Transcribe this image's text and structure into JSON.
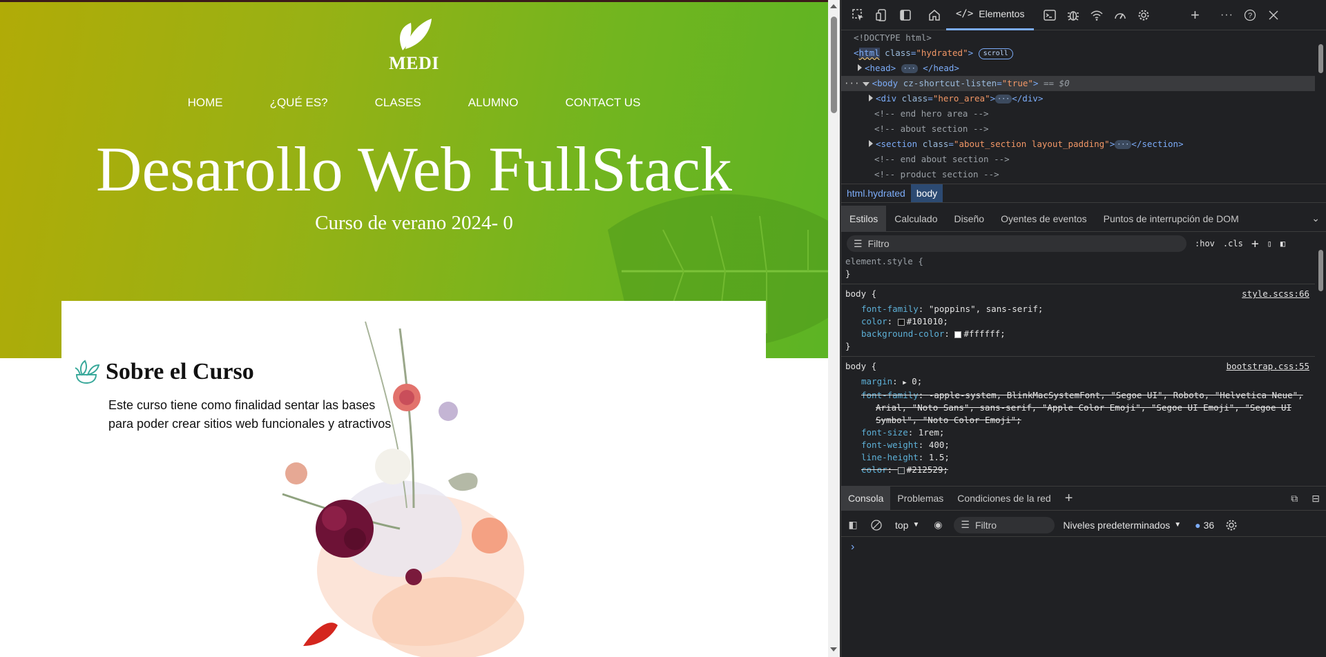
{
  "site": {
    "logo_text": "MEDI",
    "nav": [
      "HOME",
      "¿QUÉ ES?",
      "CLASES",
      "ALUMNO",
      "CONTACT US"
    ],
    "hero_title": "Desarollo Web FullStack",
    "hero_subtitle": "Curso de verano 2024- 0",
    "about_title": "Sobre el Curso",
    "about_text": "Este curso tiene como finalidad sentar las bases para poder crear sitios web funcionales y atractivos",
    "colors": {
      "hero_start": "#b1ab07",
      "hero_end": "#5cb424"
    }
  },
  "devtools": {
    "active_tab": "Elementos",
    "toolbar_icons": [
      "inspect-icon",
      "device-icon",
      "sidebar-icon",
      "home-icon",
      "elements-icon",
      "console-icon",
      "bug-icon",
      "wifi-icon",
      "performance-icon",
      "settings-gear-icon",
      "plus-icon",
      "more-icon",
      "help-icon",
      "close-icon"
    ],
    "dom": {
      "doctype": "<!DOCTYPE html>",
      "html_tag": "html",
      "html_class_attr": "class",
      "html_class_val": "\"hydrated\"",
      "scroll_badge": "scroll",
      "head_open": "<head>",
      "head_close": "</head>",
      "body_tag": "<body",
      "body_attr": "cz-shortcut-listen",
      "body_val": "\"true\"",
      "body_eq": "== $0",
      "div_open": "<div",
      "div_class": "\"hero_area\"",
      "div_close": "</div>",
      "cmt1": "<!-- end hero area -->",
      "cmt2": "<!-- about section -->",
      "section_open": "<section",
      "section_class": "\"about_section layout_padding\"",
      "section_close": "</section>",
      "cmt3": "<!-- end about section -->",
      "cmt4": "<!-- product section -->",
      "class_attr": "class",
      "dots": "···"
    },
    "breadcrumb": [
      "html.hydrated",
      "body"
    ],
    "style_tabs": [
      "Estilos",
      "Calculado",
      "Diseño",
      "Oyentes de eventos",
      "Puntos de interrupción de DOM"
    ],
    "filter_placeholder": "Filtro",
    "filter_buttons": [
      ":hov",
      ".cls"
    ],
    "rules": {
      "element_style": "element.style {",
      "close": "}",
      "body1_selector": "body {",
      "body1_source": "style.scss:66",
      "body1_props": [
        {
          "name": "font-family",
          "value": "\"poppins\", sans-serif;"
        },
        {
          "name": "color",
          "value": "#101010;",
          "swatch": "#101010"
        },
        {
          "name": "background-color",
          "value": "#ffffff;",
          "swatch": "#ffffff"
        }
      ],
      "body2_selector": "body {",
      "body2_source": "bootstrap.css:55",
      "margin_name": "margin",
      "margin_value": "0;",
      "ff_name": "font-family",
      "ff_value": "-apple-system, BlinkMacSystemFont, \"Segoe UI\", Roboto, \"Helvetica Neue\", Arial, \"Noto Sans\", sans-serif, \"Apple Color Emoji\", \"Segoe UI Emoji\", \"Segoe UI Symbol\", \"Noto Color Emoji\";",
      "fs_name": "font-size",
      "fs_value": "1rem;",
      "fw_name": "font-weight",
      "fw_value": "400;",
      "lh_name": "line-height",
      "lh_value": "1.5;",
      "c_name": "color",
      "c_value": "#212529;",
      "c_swatch": "#212529"
    },
    "console_tabs": [
      "Consola",
      "Problemas",
      "Condiciones de la red"
    ],
    "console_context": "top",
    "console_filter": "Filtro",
    "console_levels": "Niveles predeterminados",
    "console_count": "36",
    "console_prompt": "›"
  }
}
